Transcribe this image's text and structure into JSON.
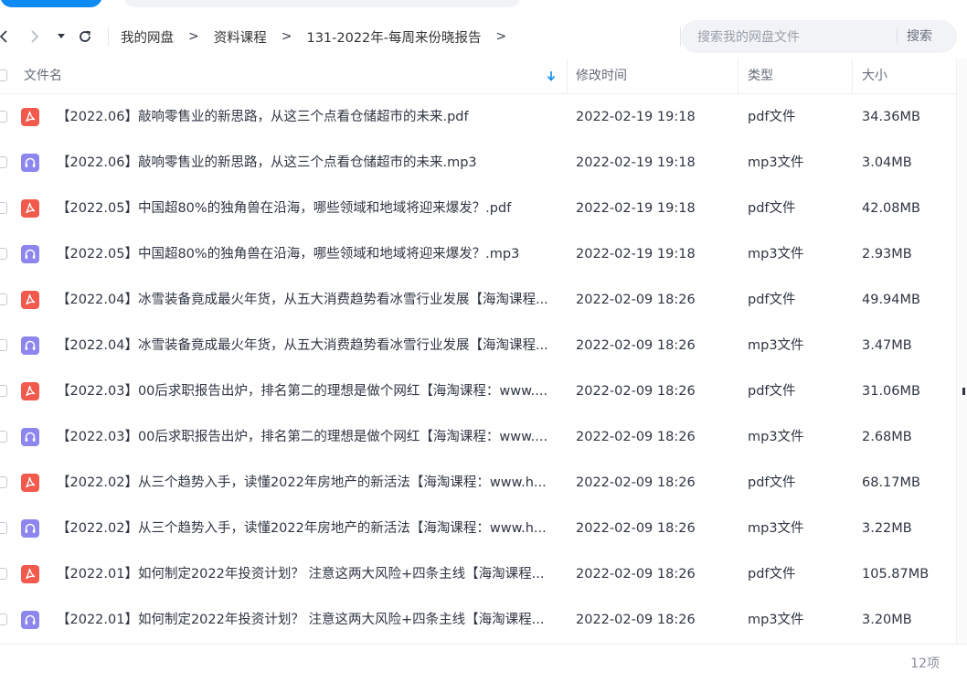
{
  "toolbar": {
    "back_icon": "chevron-left-icon",
    "forward_icon": "chevron-right-icon",
    "history_icon": "caret-down-icon",
    "refresh_icon": "refresh-icon"
  },
  "breadcrumb": {
    "items": [
      "我的网盘",
      "资料课程",
      "131-2022年-每周来份晓报告"
    ],
    "separator": ">"
  },
  "search": {
    "placeholder": "搜索我的网盘文件",
    "button_label": "搜索"
  },
  "table": {
    "columns": {
      "name": "文件名",
      "modified": "修改时间",
      "type": "类型",
      "size": "大小"
    },
    "sort_icon": "arrow-down-icon",
    "rows": [
      {
        "icon": "pdf-file-icon",
        "name": "【2022.06】敲响零售业的新思路，从这三个点看仓储超市的未来.pdf",
        "modified": "2022-02-19 19:18",
        "type": "pdf文件",
        "size": "34.36MB"
      },
      {
        "icon": "audio-file-icon",
        "name": "【2022.06】敲响零售业的新思路，从这三个点看仓储超市的未来.mp3",
        "modified": "2022-02-19 19:18",
        "type": "mp3文件",
        "size": "3.04MB"
      },
      {
        "icon": "pdf-file-icon",
        "name": "【2022.05】中国超80%的独角兽在沿海，哪些领域和地域将迎来爆发？.pdf",
        "modified": "2022-02-19 19:18",
        "type": "pdf文件",
        "size": "42.08MB"
      },
      {
        "icon": "audio-file-icon",
        "name": "【2022.05】中国超80%的独角兽在沿海，哪些领域和地域将迎来爆发？.mp3",
        "modified": "2022-02-19 19:18",
        "type": "mp3文件",
        "size": "2.93MB"
      },
      {
        "icon": "pdf-file-icon",
        "name": "【2022.04】冰雪装备竟成最火年货，从五大消费趋势看冰雪行业发展【海淘课程...",
        "modified": "2022-02-09 18:26",
        "type": "pdf文件",
        "size": "49.94MB"
      },
      {
        "icon": "audio-file-icon",
        "name": "【2022.04】冰雪装备竟成最火年货，从五大消费趋势看冰雪行业发展【海淘课程...",
        "modified": "2022-02-09 18:26",
        "type": "mp3文件",
        "size": "3.47MB"
      },
      {
        "icon": "pdf-file-icon",
        "name": "【2022.03】00后求职报告出炉，排名第二的理想是做个网红【海淘课程：www....",
        "modified": "2022-02-09 18:26",
        "type": "pdf文件",
        "size": "31.06MB"
      },
      {
        "icon": "audio-file-icon",
        "name": "【2022.03】00后求职报告出炉，排名第二的理想是做个网红【海淘课程：www....",
        "modified": "2022-02-09 18:26",
        "type": "mp3文件",
        "size": "2.68MB"
      },
      {
        "icon": "pdf-file-icon",
        "name": "【2022.02】从三个趋势入手，读懂2022年房地产的新活法【海淘课程：www.h...",
        "modified": "2022-02-09 18:26",
        "type": "pdf文件",
        "size": "68.17MB"
      },
      {
        "icon": "audio-file-icon",
        "name": "【2022.02】从三个趋势入手，读懂2022年房地产的新活法【海淘课程：www.h...",
        "modified": "2022-02-09 18:26",
        "type": "mp3文件",
        "size": "3.22MB"
      },
      {
        "icon": "pdf-file-icon",
        "name": "【2022.01】如何制定2022年投资计划？ 注意这两大风险+四条主线【海淘课程...",
        "modified": "2022-02-09 18:26",
        "type": "pdf文件",
        "size": "105.87MB"
      },
      {
        "icon": "audio-file-icon",
        "name": "【2022.01】如何制定2022年投资计划？ 注意这两大风险+四条主线【海淘课程...",
        "modified": "2022-02-09 18:26",
        "type": "mp3文件",
        "size": "3.20MB"
      }
    ]
  },
  "footer": {
    "count": "12项"
  },
  "colors": {
    "accent": "#0d8bf2",
    "pdf_icon": "#f25a4d",
    "audio_icon": "#8c86ee",
    "search_bg": "#f1f3f7"
  }
}
